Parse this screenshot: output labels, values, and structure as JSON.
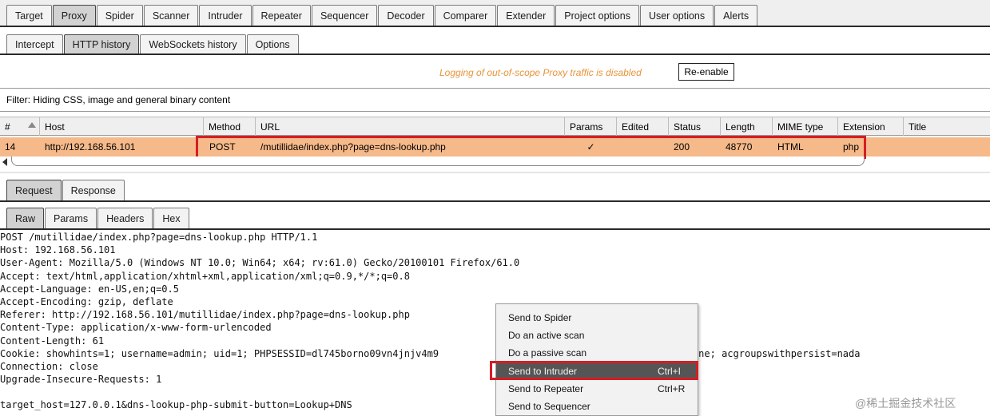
{
  "top_tabs": [
    "Target",
    "Proxy",
    "Spider",
    "Scanner",
    "Intruder",
    "Repeater",
    "Sequencer",
    "Decoder",
    "Comparer",
    "Extender",
    "Project options",
    "User options",
    "Alerts"
  ],
  "proxy_tabs": [
    "Intercept",
    "HTTP history",
    "WebSockets history",
    "Options"
  ],
  "notice": {
    "text": "Logging of out-of-scope Proxy traffic is disabled",
    "button": "Re-enable",
    "color": "#e8943a"
  },
  "filter_text": "Filter: Hiding CSS, image and general binary content",
  "history": {
    "columns": [
      "#",
      "Host",
      "Method",
      "URL",
      "Params",
      "Edited",
      "Status",
      "Length",
      "MIME type",
      "Extension",
      "Title"
    ],
    "rows": [
      {
        "num": "14",
        "host": "http://192.168.56.101",
        "method": "POST",
        "url": "/mutillidae/index.php?page=dns-lookup.php",
        "params": "✓",
        "edited": "",
        "status": "200",
        "length": "48770",
        "mime": "HTML",
        "ext": "php",
        "title": ""
      }
    ],
    "selected_color": "#f6b98a"
  },
  "message_tabs": [
    "Request",
    "Response"
  ],
  "view_tabs": [
    "Raw",
    "Params",
    "Headers",
    "Hex"
  ],
  "request_lines": [
    "POST /mutillidae/index.php?page=dns-lookup.php HTTP/1.1",
    "Host: 192.168.56.101",
    "User-Agent: Mozilla/5.0 (Windows NT 10.0; Win64; x64; rv:61.0) Gecko/20100101 Firefox/61.0",
    "Accept: text/html,application/xhtml+xml,application/xml;q=0.9,*/*;q=0.8",
    "Accept-Language: en-US,en;q=0.5",
    "Accept-Encoding: gzip, deflate",
    "Referer: http://192.168.56.101/mutillidae/index.php?page=dns-lookup.php",
    "Content-Type: application/x-www-form-urlencoded",
    "Content-Length: 61",
    "Cookie: showhints=1; username=admin; uid=1; PHPSESSID=dl745borno09vn4jnjv4m9                              to,phpbb2,redmine; acgroupswithpersist=nada",
    "Connection: close",
    "Upgrade-Insecure-Requests: 1",
    "",
    "target_host=127.0.0.1&dns-lookup-php-submit-button=Lookup+DNS"
  ],
  "context_menu": [
    {
      "label": "Send to Spider",
      "shortcut": ""
    },
    {
      "label": "Do an active scan",
      "shortcut": ""
    },
    {
      "label": "Do a passive scan",
      "shortcut": ""
    },
    {
      "label": "Send to Intruder",
      "shortcut": "Ctrl+I",
      "highlighted": true
    },
    {
      "label": "Send to Repeater",
      "shortcut": "Ctrl+R"
    },
    {
      "label": "Send to Sequencer",
      "shortcut": ""
    }
  ],
  "highlight_color": "#d31e24",
  "watermark": "@稀土掘金技术社区"
}
